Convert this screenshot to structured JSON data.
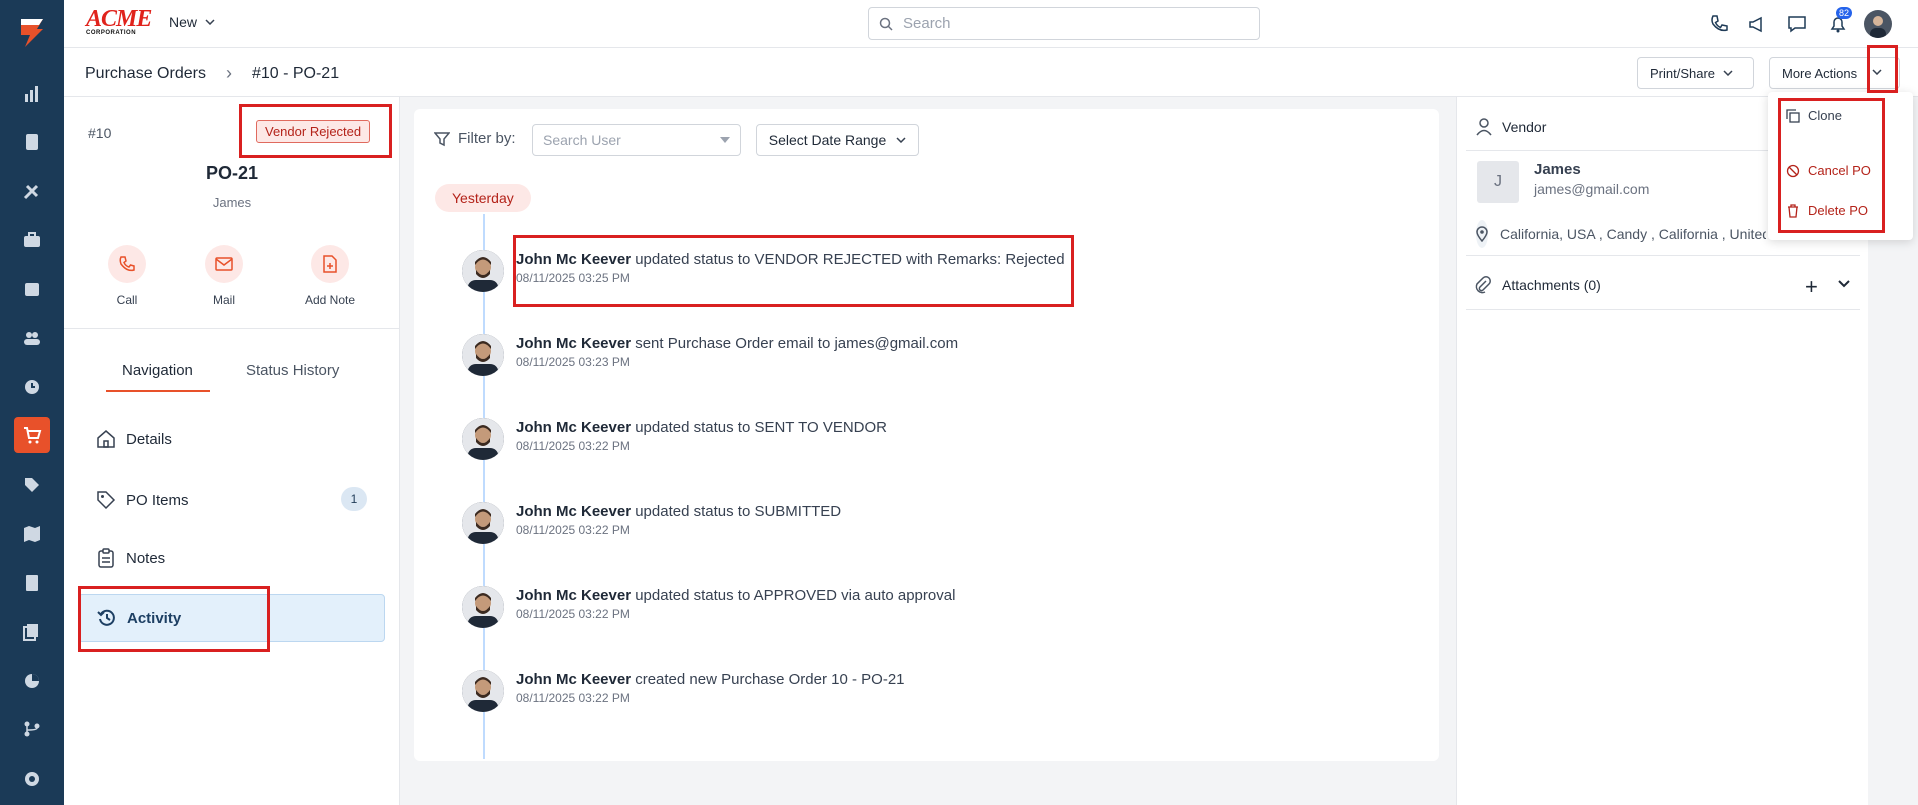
{
  "brand": {
    "logo_top": "ACME",
    "logo_bottom": "CORPORATION"
  },
  "topbar": {
    "new_label": "New",
    "search_placeholder": "Search",
    "notification_count": "82"
  },
  "breadcrumb": {
    "parent": "Purchase Orders",
    "current": "#10 - PO-21"
  },
  "header_actions": {
    "print_share": "Print/Share",
    "more_actions": "More Actions"
  },
  "more_actions_menu": [
    "Clone",
    "Cancel PO",
    "Delete PO"
  ],
  "po": {
    "number": "#10",
    "status": "Vendor Rejected",
    "title": "PO-21",
    "vendor": "James"
  },
  "quick_actions": [
    "Call",
    "Mail",
    "Add Note"
  ],
  "tabs": [
    "Navigation",
    "Status History"
  ],
  "nav_items": [
    {
      "label": "Details",
      "icon": "home-icon"
    },
    {
      "label": "PO Items",
      "icon": "tag-icon",
      "count": "1"
    },
    {
      "label": "Notes",
      "icon": "clipboard-icon"
    },
    {
      "label": "Activity",
      "icon": "history-icon",
      "active": true
    }
  ],
  "filters": {
    "label": "Filter by:",
    "user_placeholder": "Search User",
    "date_range": "Select Date Range"
  },
  "timeline_group": "Yesterday",
  "activities": [
    {
      "user": "John Mc Keever",
      "text": " updated status to VENDOR REJECTED with Remarks: Rejected",
      "time": "08/11/2025 03:25 PM"
    },
    {
      "user": "John Mc Keever",
      "text": " sent Purchase Order email to james@gmail.com",
      "time": "08/11/2025 03:23 PM"
    },
    {
      "user": "John Mc Keever",
      "text": " updated status to SENT TO VENDOR",
      "time": "08/11/2025 03:22 PM"
    },
    {
      "user": "John Mc Keever",
      "text": " updated status to SUBMITTED",
      "time": "08/11/2025 03:22 PM"
    },
    {
      "user": "John Mc Keever",
      "text": " updated status to APPROVED via auto approval",
      "time": "08/11/2025 03:22 PM"
    },
    {
      "user": "John Mc Keever",
      "text": " created new Purchase Order 10 - PO-21",
      "time": "08/11/2025 03:22 PM"
    }
  ],
  "vendor_panel": {
    "heading": "Vendor",
    "initial": "J",
    "name": "James",
    "email": "james@gmail.com",
    "address": "California, USA , Candy , California , United States",
    "attachments_label": "Attachments (0)"
  },
  "colors": {
    "accent": "#e8512a",
    "rail": "#1b3a57",
    "highlight": "#d92020"
  }
}
